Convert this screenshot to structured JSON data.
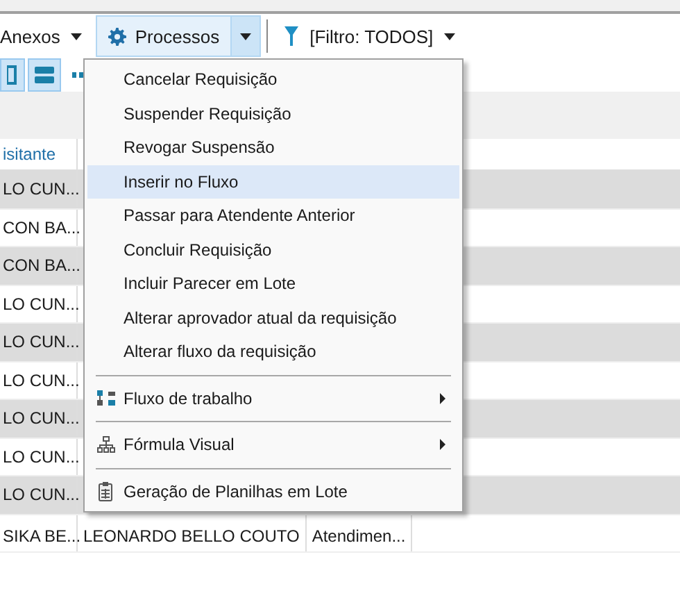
{
  "toolbar": {
    "items": [
      {
        "label": "Anexos",
        "kind": "dropdown",
        "selected": false
      },
      {
        "label": "Processos",
        "kind": "split",
        "selected": true
      },
      {
        "label": "[Filtro: TODOS]",
        "kind": "filter",
        "selected": false
      }
    ]
  },
  "table": {
    "columns": [
      "isitante"
    ],
    "rows": [
      {
        "cells": [
          "LO CUN..."
        ]
      },
      {
        "cells": [
          "CON BA..."
        ]
      },
      {
        "cells": [
          "CON BA..."
        ]
      },
      {
        "cells": [
          "LO CUN..."
        ]
      },
      {
        "cells": [
          "LO CUN..."
        ]
      },
      {
        "cells": [
          "LO CUN..."
        ]
      },
      {
        "cells": [
          "LO CUN..."
        ]
      },
      {
        "cells": [
          "LO CUN..."
        ]
      },
      {
        "cells": [
          "LO CUN..."
        ]
      },
      {
        "cells": [
          "SIKA BE...",
          "LEONARDO BELLO COUTO",
          "Atendimen..."
        ]
      }
    ]
  },
  "menu": {
    "groups": [
      {
        "items": [
          {
            "label": "Cancelar Requisição",
            "selected": false,
            "submenu": false
          },
          {
            "label": "Suspender Requisição",
            "selected": false,
            "submenu": false
          },
          {
            "label": "Revogar Suspensão",
            "selected": false,
            "submenu": false
          },
          {
            "label": "Inserir no Fluxo",
            "selected": true,
            "submenu": false
          },
          {
            "label": "Passar para Atendente Anterior",
            "selected": false,
            "submenu": false
          },
          {
            "label": "Concluir Requisição",
            "selected": false,
            "submenu": false
          },
          {
            "label": "Incluir Parecer em Lote",
            "selected": false,
            "submenu": false
          },
          {
            "label": "Alterar aprovador atual da requisição",
            "selected": false,
            "submenu": false
          },
          {
            "label": "Alterar fluxo da requisição",
            "selected": false,
            "submenu": false
          }
        ]
      },
      {
        "items": [
          {
            "label": "Fluxo de trabalho",
            "selected": false,
            "submenu": true
          }
        ]
      },
      {
        "items": [
          {
            "label": "Fórmula Visual",
            "selected": false,
            "submenu": true
          }
        ]
      },
      {
        "items": [
          {
            "label": "Geração de Planilhas em Lote",
            "selected": false,
            "submenu": false
          }
        ]
      }
    ]
  }
}
